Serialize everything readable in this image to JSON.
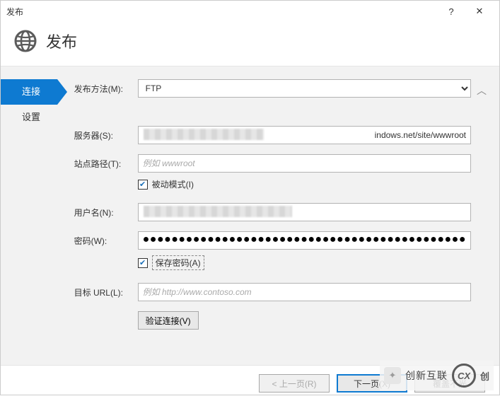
{
  "titlebar": {
    "title": "发布",
    "help": "?",
    "close": "✕"
  },
  "header": {
    "title": "发布"
  },
  "sidebar": {
    "items": [
      {
        "label": "连接",
        "active": true
      },
      {
        "label": "设置",
        "active": false
      }
    ]
  },
  "form": {
    "publishMethod": {
      "label": "发布方法(M):",
      "value": "FTP"
    },
    "server": {
      "label": "服务器(S):",
      "value": "indows.net/site/wwwroot"
    },
    "sitePath": {
      "label": "站点路径(T):",
      "placeholder": "例如 wwwroot"
    },
    "passiveMode": {
      "label": "被动模式(I)",
      "checked": true
    },
    "username": {
      "label": "用户名(N):",
      "value": ""
    },
    "password": {
      "label": "密码(W):",
      "masked": "●●●●●●●●●●●●●●●●●●●●●●●●●●●●●●●●●●●●●●●●●●●●●"
    },
    "savePassword": {
      "label": "保存密码(A)",
      "checked": true
    },
    "destUrl": {
      "label": "目标 URL(L):",
      "placeholder": "例如 http://www.contoso.com"
    },
    "validate": {
      "label": "验证连接(V)"
    }
  },
  "footer": {
    "prev": "< 上一页(R)",
    "next": "下一页(X)",
    "extra": "覆盖不光"
  },
  "watermark": {
    "brand": "创新互联",
    "logo": "CX"
  }
}
